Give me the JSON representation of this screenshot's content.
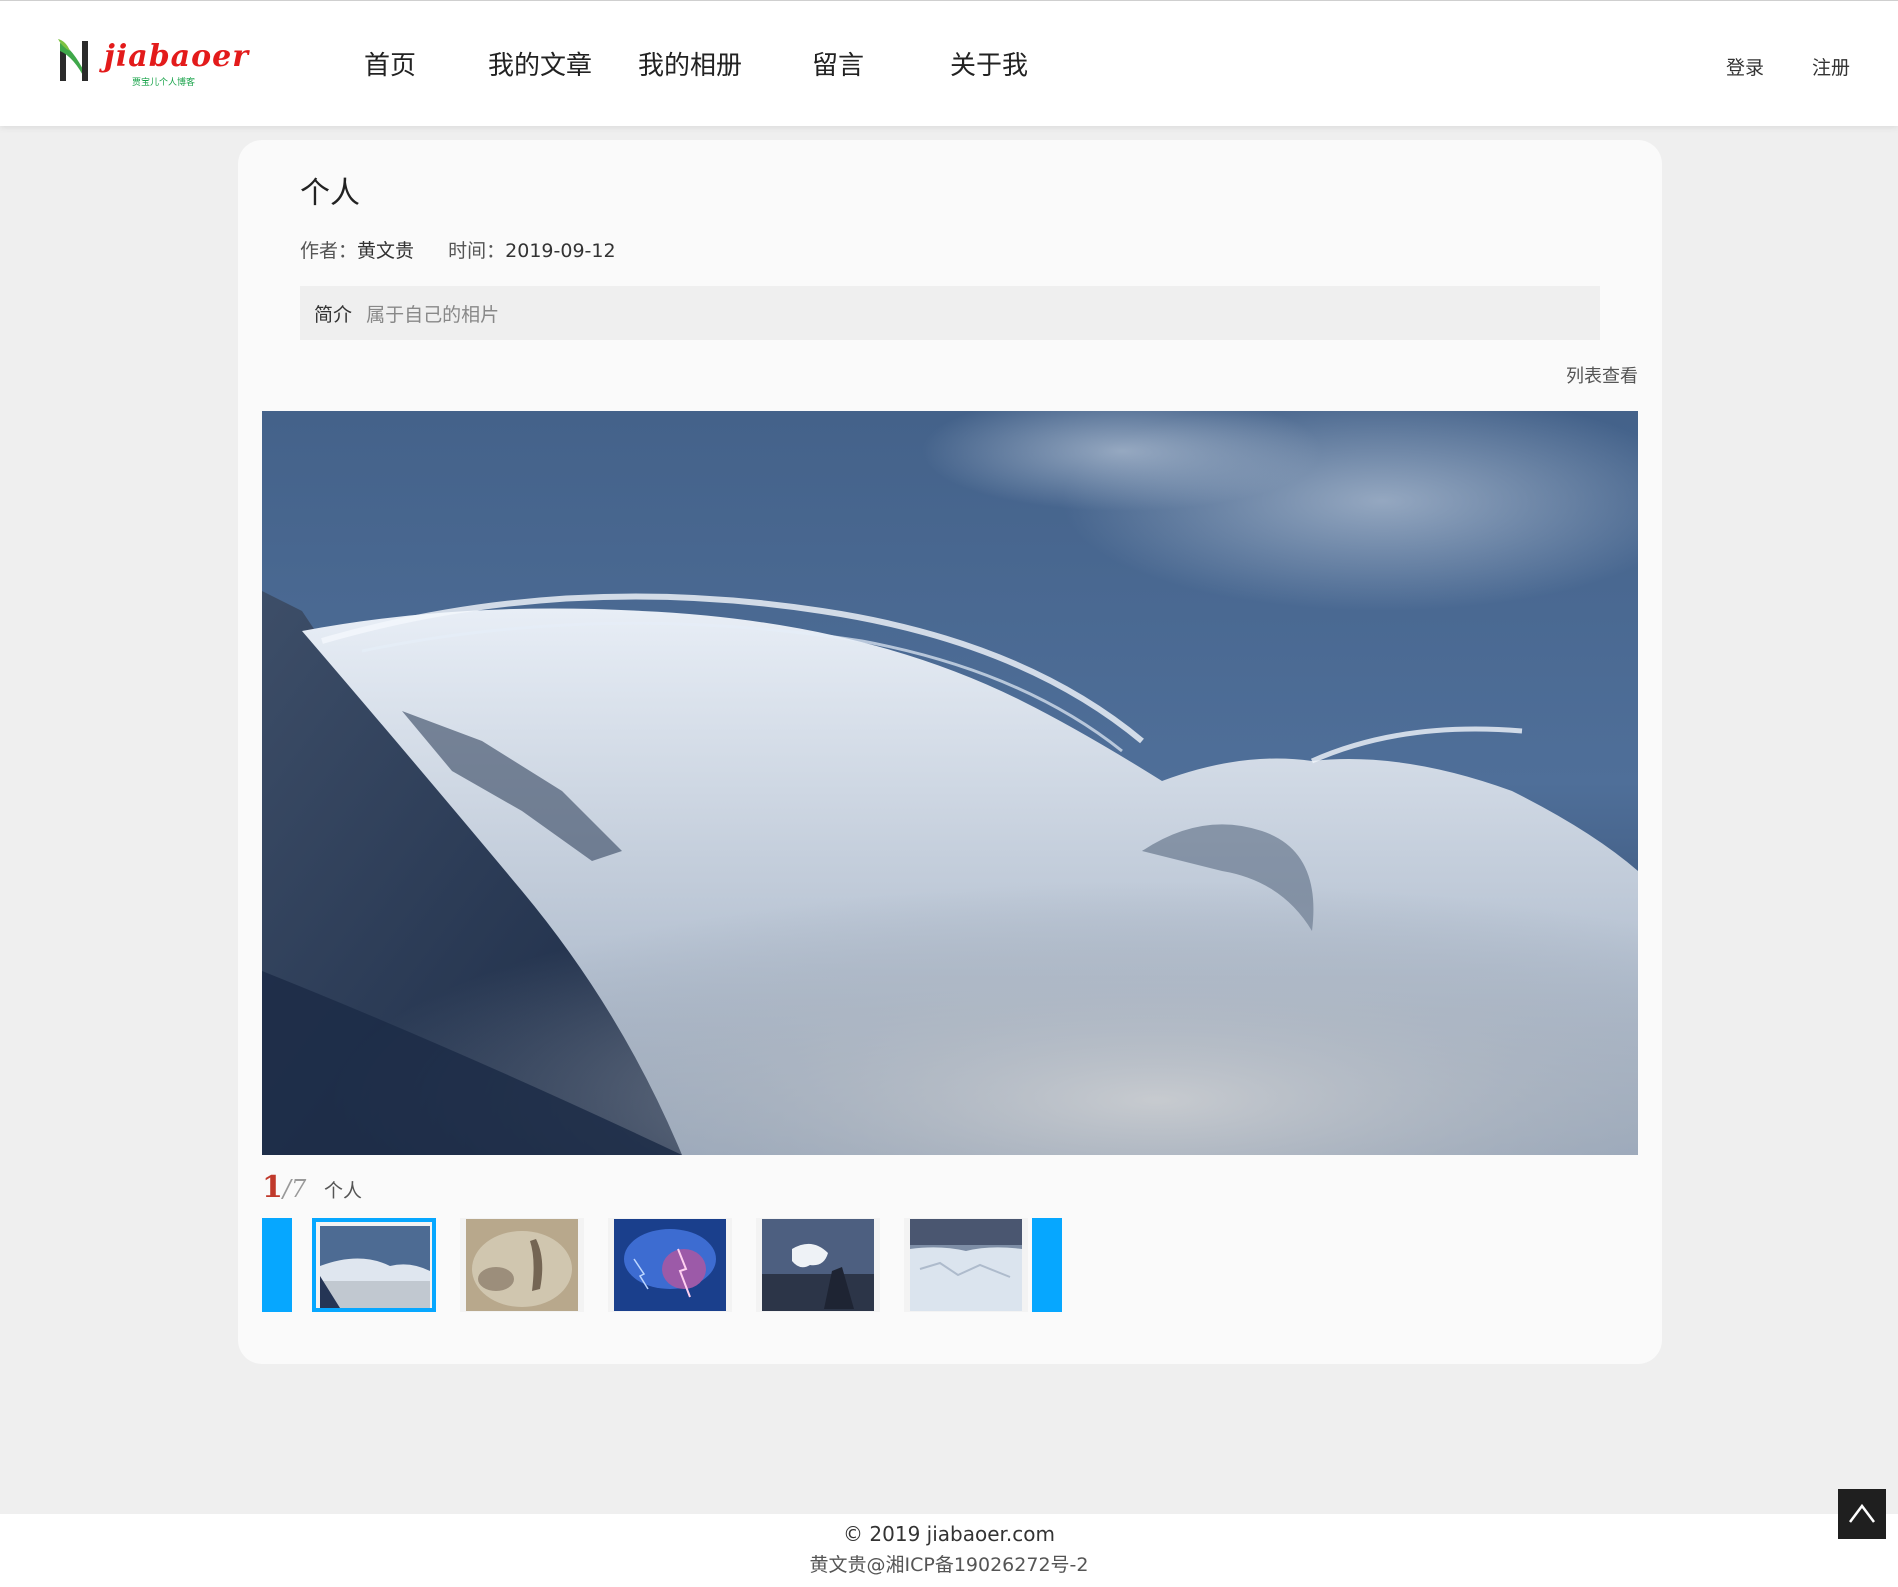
{
  "header": {
    "logo_text": "jiabaoer",
    "logo_sub": "贾宝儿个人博客",
    "nav": [
      "首页",
      "我的文章",
      "我的相册",
      "留言",
      "关于我"
    ],
    "login": "登录",
    "register": "注册"
  },
  "album": {
    "title": "个人",
    "author_label": "作者：",
    "author": "黄文贵",
    "time_label": "时间：",
    "time": "2019-09-12",
    "intro_label": "简介",
    "intro_text": "属于自己的相片",
    "list_view": "列表查看",
    "current": "1",
    "separator": "/",
    "total": "7",
    "caption": "个人"
  },
  "footer": {
    "copyright": "© 2019  jiabaoer.com",
    "icp": "黄文贵@湘ICP备19026272号-2"
  },
  "colors": {
    "accent": "#06a7ff",
    "counter": "#c0392b",
    "logo": "#e31b1b"
  },
  "icons": {
    "to_top": "chevron-up-icon",
    "prev": "prev-arrow-icon",
    "next": "next-arrow-icon"
  }
}
